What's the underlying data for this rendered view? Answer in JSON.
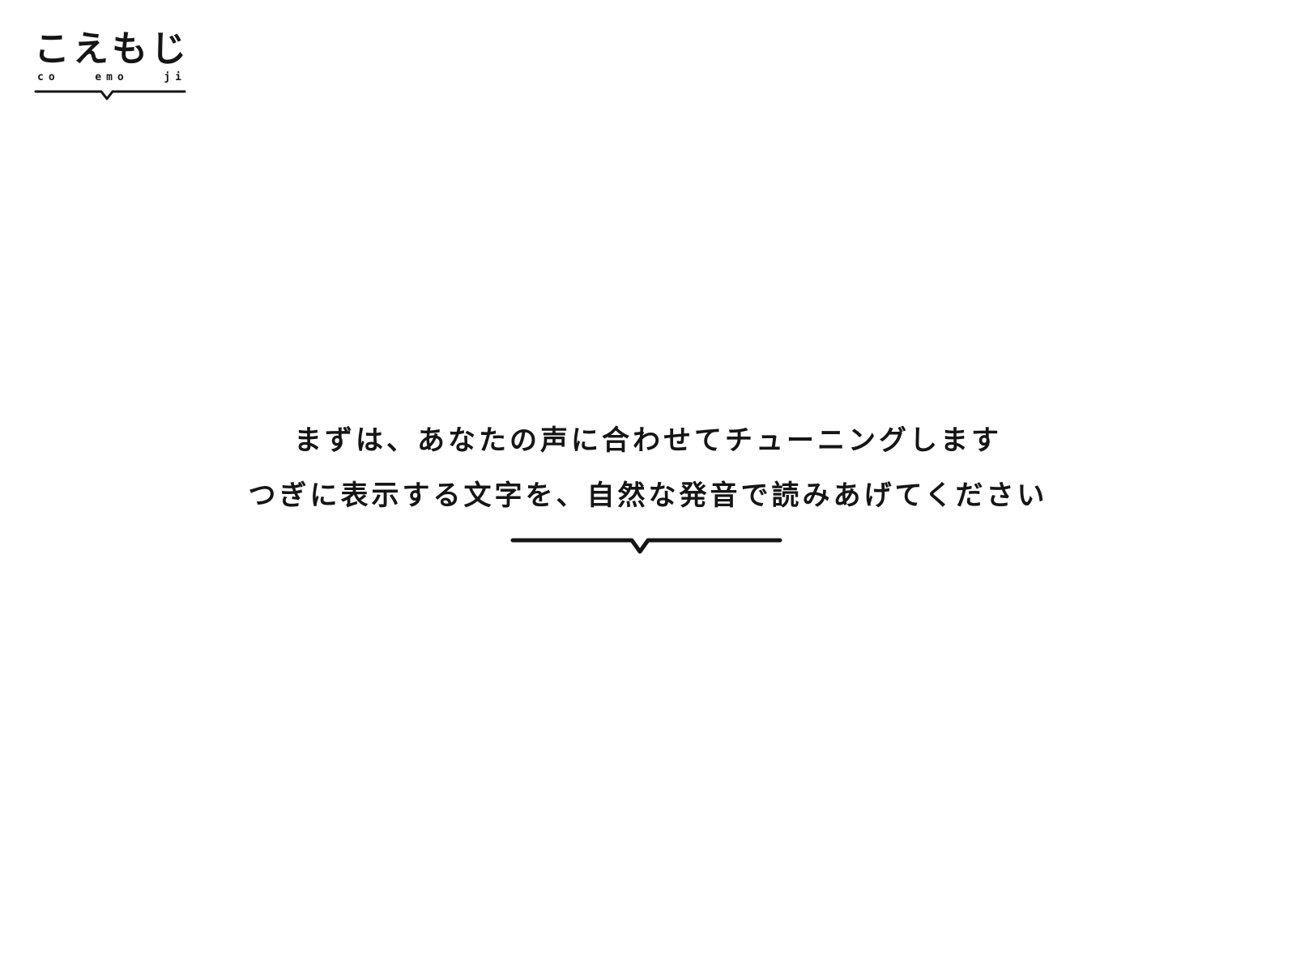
{
  "logo": {
    "main_chars": [
      "こ",
      "え",
      "も",
      "じ"
    ],
    "sub_parts": [
      "co",
      "emo",
      "ji"
    ]
  },
  "instructions": {
    "line1": "まずは、あなたの声に合わせてチューニングします",
    "line2": "つぎに表示する文字を、自然な発音で読みあげてください"
  },
  "colors": {
    "text": "#151515",
    "background": "#ffffff"
  }
}
